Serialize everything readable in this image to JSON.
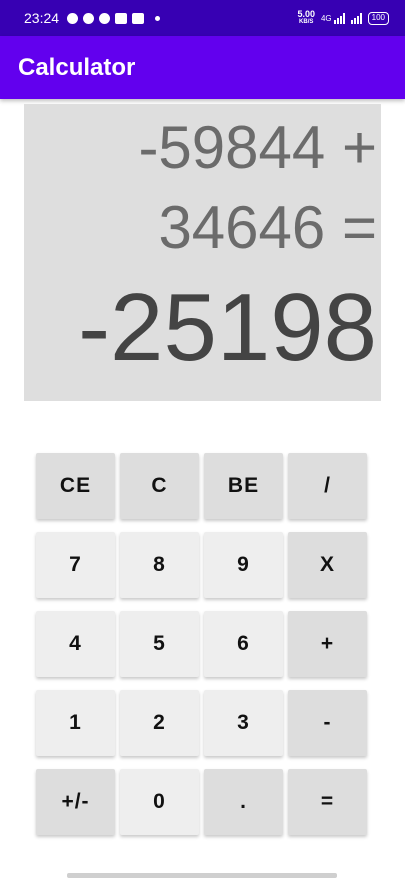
{
  "status_bar": {
    "time": "23:24",
    "speed_value": "5.00",
    "speed_unit": "KB/S",
    "network": "4G",
    "battery": "100",
    "icons": [
      "messenger-icon",
      "facebook-icon",
      "facebook-icon",
      "vpn-icon",
      "notification-icon",
      "dot-icon",
      "signal-icon",
      "signal-icon",
      "battery-icon"
    ]
  },
  "app": {
    "title": "Calculator",
    "theme_color": "#6200ee",
    "status_color": "#3700b3"
  },
  "display": {
    "expression_line1": "-59844 +",
    "expression_line2": "34646 =",
    "result": "-25198"
  },
  "keypad": {
    "row1": [
      "CE",
      "C",
      "BE",
      "/"
    ],
    "row2": [
      "7",
      "8",
      "9",
      "X"
    ],
    "row3": [
      "4",
      "5",
      "6",
      "+"
    ],
    "row4": [
      "1",
      "2",
      "3",
      "-"
    ],
    "row5": [
      "+/-",
      "0",
      ".",
      "="
    ]
  }
}
